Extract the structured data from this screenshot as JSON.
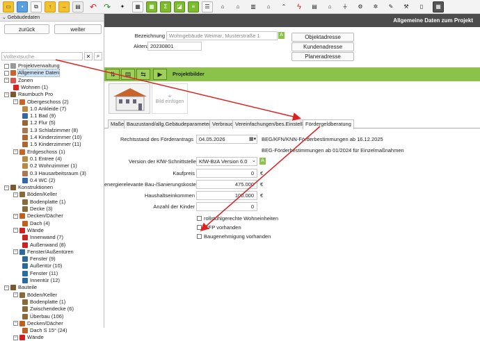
{
  "toolbar": {
    "icons": [
      "folder-icon",
      "save-icon",
      "copy-icon",
      "folder-up-icon",
      "folder-export-icon",
      "undo-icon",
      "redo-icon",
      "wand-icon",
      "report-icon",
      "grid-icon",
      "sum-icon",
      "chart-icon",
      "list-icon",
      "house-icon",
      "house2-icon",
      "building-icon",
      "dwelling-icon",
      "lightning-icon",
      "heat-icon",
      "dwelling2-icon",
      "plug-icon",
      "tool-icon",
      "calculator-icon"
    ]
  },
  "left": {
    "header": "Gebäudedaten",
    "back": "zurück",
    "forward": "weiter",
    "search_placeholder": "Volltextsuche",
    "tree": [
      "Projektverwaltung",
      "Allgemeine Daten",
      "Zonen",
      "Wohnen (1)",
      "Raumbuch Pro",
      "Obergeschoss (2)",
      "1.0 Ankleide (7)",
      "1.1 Bad (9)",
      "1.2 Flur (5)",
      "1.3 Schlafzimmer (8)",
      "1.4 Kinderzimmer (10)",
      "1.5 Kinderzimmer (11)",
      "Erdgeschoss (1)",
      "0.1 Entree (4)",
      "0.2 Wohnzimmer (1)",
      "0.3 Hausarbeitsraum (3)",
      "0.4 WC (2)",
      "Konstruktionen",
      "Böden/Keller",
      "Bodenplatte (1)",
      "Decke (3)",
      "Decken/Dächer",
      "Dach (4)",
      "Wände",
      "Innenwand (7)",
      "Außenwand (8)",
      "Fenster/Außentüren",
      "Fenster (9)",
      "Außentür (10)",
      "Fenster (11)",
      "Innentür (12)",
      "Bauteile",
      "Böden/Keller",
      "Bodenplatte (1)",
      "Zwischendecke (6)",
      "Überbau (106)",
      "Decken/Dächer",
      "Dach S 15° (24)",
      "Wände"
    ]
  },
  "main": {
    "title": "Allgemeine Daten zum Projekt",
    "bezeichnung_label": "Bezeichnung",
    "bezeichnung_value": "Wohngebäude Weimar, Musterstraße 1",
    "aktenzeichen_label": "Aktenzeichen",
    "aktenzeichen_value": "20230801",
    "objektadresse": "Objektadresse",
    "kundenadresse": "Kundenadresse",
    "planeradresse": "Planeradresse",
    "projektbilder": "Projektbilder",
    "bild_einfuegen": "Bild einfügen",
    "tabs": [
      "Maße",
      "Bauzustand/allg.Gebäudeparameter",
      "Verbrauch",
      "Vereinfachungen/bes.Einstellungen",
      "Fördergeldberatung"
    ],
    "rechtsstand_label": "Rechtsstand des Förderantrags",
    "rechtsstand_value": "04.05.2026",
    "rechtsstand_info1": "BEG/KFN/KNN-Förderbestimmungen ab 16.12.2025",
    "rechtsstand_info2": "BEG-Förderbestimmungen ab 01/2024 für Einzelmaßnahmen",
    "kfw_label": "Version der KfW-Schnittstelle",
    "kfw_value": "KfW-BzA Version 6.0",
    "kaufpreis_label": "Kaufpreis",
    "kaufpreis_value": "0",
    "baukosten_label": "energierelevante Bau-/Sanierungskosten",
    "baukosten_value": "475.000",
    "einkommen_label": "Haushaltseinkommen",
    "einkommen_value": "100.000",
    "kinder_label": "Anzahl der Kinder",
    "kinder_value": "0",
    "euro": "€",
    "cb1": "rollstuhlgerechte Wohneinheiten",
    "cb2": "iSFP vorhanden",
    "cb3": "Baugenehmigung vorhanden"
  },
  "colors": {
    "accent_green": "#8bc34a",
    "arrow_red": "#e02020",
    "header_dark": "#4c4c4c"
  }
}
